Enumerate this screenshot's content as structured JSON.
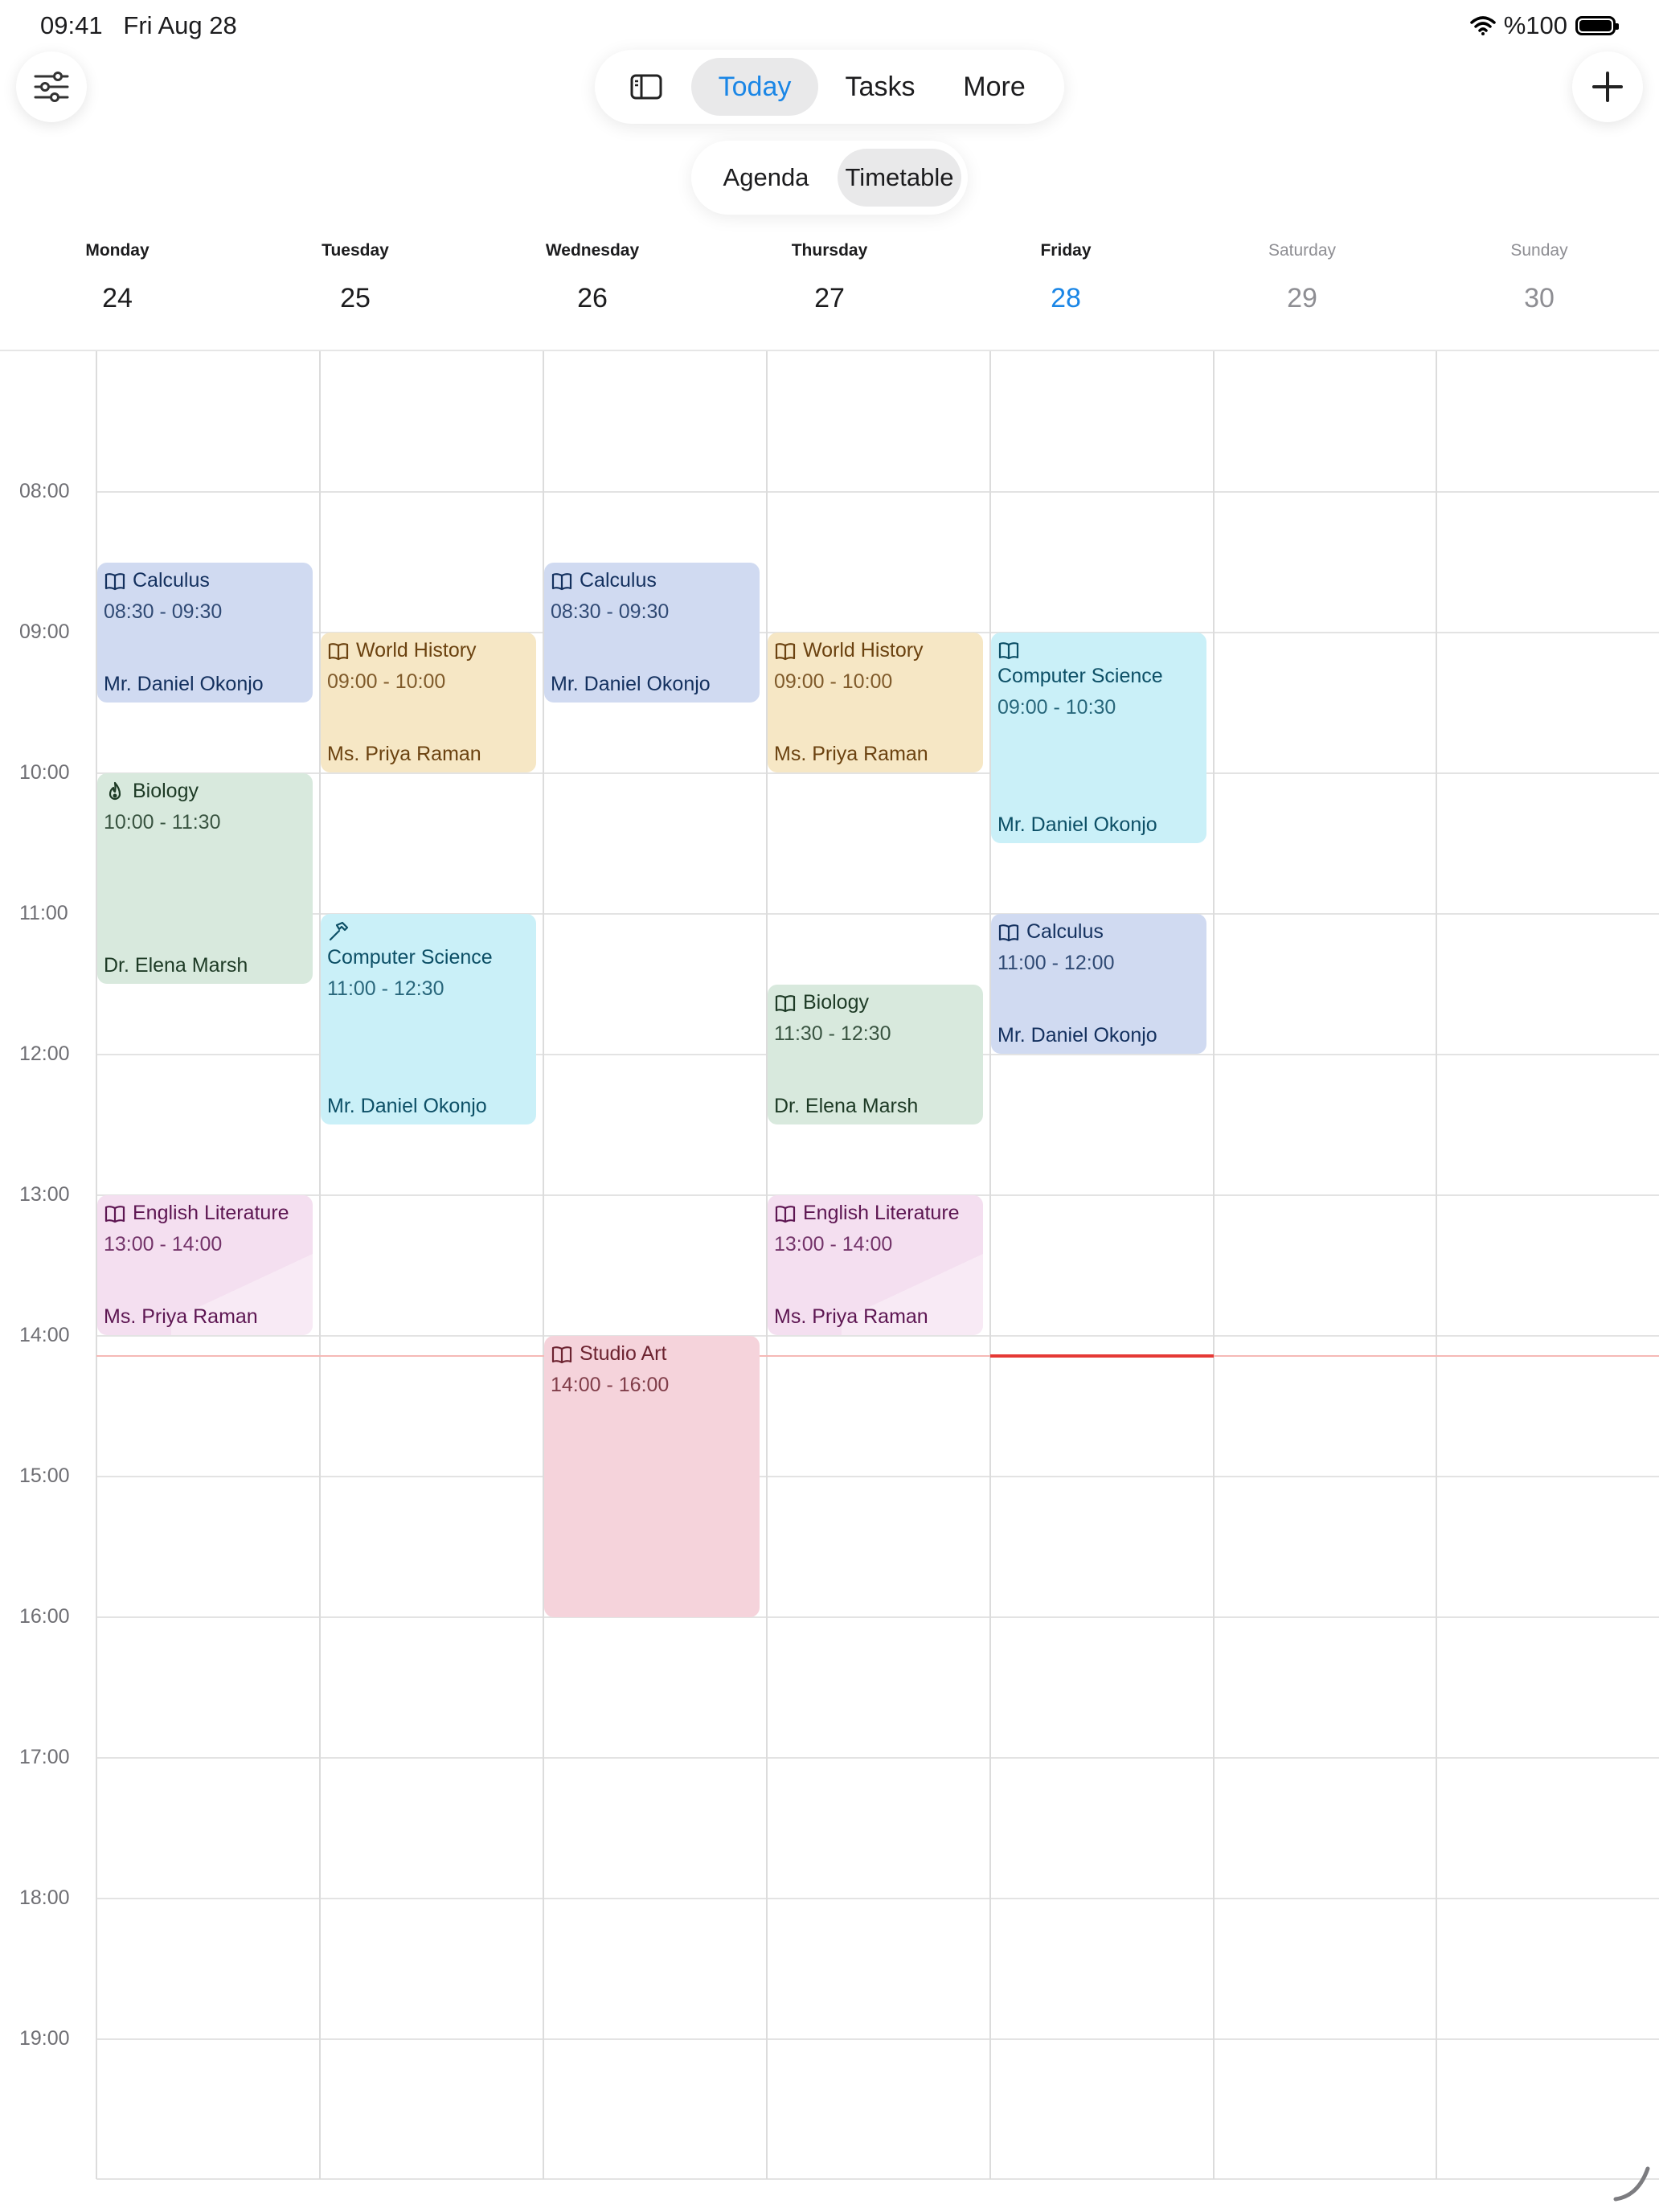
{
  "status": {
    "time": "09:41",
    "date": "Fri Aug 28",
    "battery": "%100"
  },
  "nav": {
    "today": "Today",
    "tasks": "Tasks",
    "more": "More"
  },
  "view": {
    "agenda": "Agenda",
    "timetable": "Timetable"
  },
  "days": [
    {
      "name": "Monday",
      "num": "24"
    },
    {
      "name": "Tuesday",
      "num": "25"
    },
    {
      "name": "Wednesday",
      "num": "26"
    },
    {
      "name": "Thursday",
      "num": "27"
    },
    {
      "name": "Friday",
      "num": "28"
    },
    {
      "name": "Saturday",
      "num": "29"
    },
    {
      "name": "Sunday",
      "num": "30"
    }
  ],
  "hours": [
    "08:00",
    "09:00",
    "10:00",
    "11:00",
    "12:00",
    "13:00",
    "14:00",
    "15:00",
    "16:00",
    "17:00",
    "18:00",
    "19:00"
  ],
  "events": [
    {
      "title": "Calculus",
      "time": "08:30 - 09:30",
      "teacher": "Mr. Daniel Okonjo"
    },
    {
      "title": "Calculus",
      "time": "08:30 - 09:30",
      "teacher": "Mr. Daniel Okonjo"
    },
    {
      "title": "World History",
      "time": "09:00 - 10:00",
      "teacher": "Ms. Priya Raman"
    },
    {
      "title": "World History",
      "time": "09:00 - 10:00",
      "teacher": "Ms. Priya Raman"
    },
    {
      "title": "Computer Science",
      "time": "09:00 - 10:30",
      "teacher": "Mr. Daniel Okonjo"
    },
    {
      "title": "Biology",
      "time": "10:00 - 11:30",
      "teacher": "Dr. Elena Marsh"
    },
    {
      "title": "Computer Science",
      "time": "11:00 - 12:30",
      "teacher": "Mr. Daniel Okonjo"
    },
    {
      "title": "Calculus",
      "time": "11:00 - 12:00",
      "teacher": "Mr. Daniel Okonjo"
    },
    {
      "title": "Biology",
      "time": "11:30 - 12:30",
      "teacher": "Dr. Elena Marsh"
    },
    {
      "title": "English Literature",
      "time": "13:00 - 14:00",
      "teacher": "Ms. Priya Raman"
    },
    {
      "title": "English Literature",
      "time": "13:00 - 14:00",
      "teacher": "Ms. Priya Raman"
    },
    {
      "title": "Studio Art",
      "time": "14:00 - 16:00",
      "teacher": ""
    }
  ],
  "icons": {
    "settings": "sliders-icon",
    "sidebar": "sidebar-icon",
    "add": "plus-icon",
    "subject_book": "book-icon",
    "subject_biology": "flame-icon",
    "subject_cs": "hammer-icon"
  },
  "colors": {
    "accent": "#1a86e6",
    "now_line": "#e53935",
    "calculus": "#d0daf1",
    "world_history": "#f6e7c5",
    "computer_science": "#caf0f8",
    "biology": "#d8e9dd",
    "english_literature": "#f4dff0",
    "studio_art": "#f5d3db"
  }
}
